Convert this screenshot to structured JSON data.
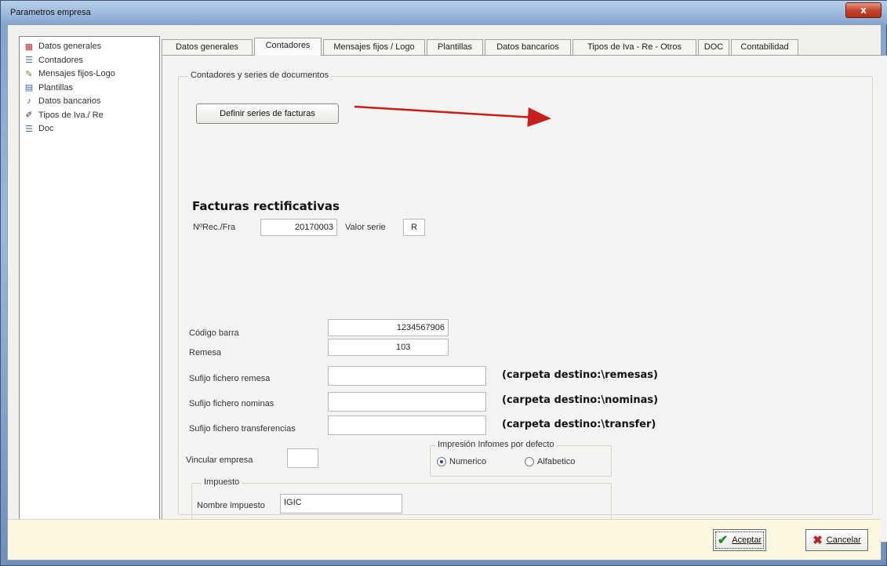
{
  "window": {
    "title": "Parametros empresa",
    "close_label": "x"
  },
  "tree": {
    "items": [
      {
        "label": "Datos generales",
        "icon": "building-icon",
        "glyph": "▦",
        "color": "#b03030"
      },
      {
        "label": "Contadores",
        "icon": "list-icon",
        "glyph": "☰",
        "color": "#5070a0"
      },
      {
        "label": "Mensajes fijos-Logo",
        "icon": "message-icon",
        "glyph": "✎",
        "color": "#6a8a30"
      },
      {
        "label": "Plantillas",
        "icon": "template-icon",
        "glyph": "▤",
        "color": "#3a6aa0"
      },
      {
        "label": "Datos bancarios",
        "icon": "bank-icon",
        "glyph": "♪",
        "color": "#3050a0"
      },
      {
        "label": "Tipos de Iva./ Re",
        "icon": "pencil-icon",
        "glyph": "✐",
        "color": "#303030"
      },
      {
        "label": "Doc",
        "icon": "list-icon",
        "glyph": "☰",
        "color": "#5070a0"
      }
    ]
  },
  "tabs": [
    {
      "label": "Datos generales",
      "active": false
    },
    {
      "label": "Contadores",
      "active": true
    },
    {
      "label": "Mensajes fijos  / Logo",
      "active": false
    },
    {
      "label": "Plantillas",
      "active": false
    },
    {
      "label": "Datos bancarios",
      "active": false
    },
    {
      "label": "Tipos de Iva - Re - Otros",
      "active": false
    },
    {
      "label": "DOC",
      "active": false
    },
    {
      "label": "Contabilidad",
      "active": false
    }
  ],
  "contadores": {
    "group_label": "Contadores y series de documentos",
    "series_button": "Definir series de facturas",
    "rectificativas_heading": "Facturas rectificativas",
    "nrec_label": "NºRec./Fra",
    "nrec_value": "20170003",
    "valor_serie_label": "Valor serie",
    "valor_serie_value": "R",
    "codigo_barra_label": "Código barra",
    "codigo_barra_value": "1234567906",
    "remesa_label": "Remesa",
    "remesa_value": "103",
    "sufijo_remesa_label": "Sufijo fichero remesa",
    "sufijo_remesa_value": "",
    "sufijo_remesa_hint": "(carpeta destino:\\remesas)",
    "sufijo_nominas_label": "Sufijo fichero nominas",
    "sufijo_nominas_value": "",
    "sufijo_nominas_hint": "(carpeta destino:\\nominas)",
    "sufijo_transf_label": "Sufijo fichero transferencias",
    "sufijo_transf_value": "",
    "sufijo_transf_hint": "(carpeta destino:\\transfer)",
    "vincular_label": "Vincular empresa",
    "vincular_value": "",
    "impresion_group_label": "Impresión Infomes por defecto",
    "radio_numerico": "Numerico",
    "radio_alfabetico": "Alfabetico",
    "radio_selected": "numerico",
    "impuesto_group_label": "Impuesto",
    "nombre_impuesto_label": "Nombre impuesto",
    "nombre_impuesto_value": "IGIC"
  },
  "footer": {
    "ok_label": "Aceptar",
    "cancel_label": "Cancelar",
    "ok_icon_color": "#2a8a2a",
    "cancel_icon_color": "#c02020"
  },
  "annotation": {
    "arrow_color": "#c81e1e"
  }
}
